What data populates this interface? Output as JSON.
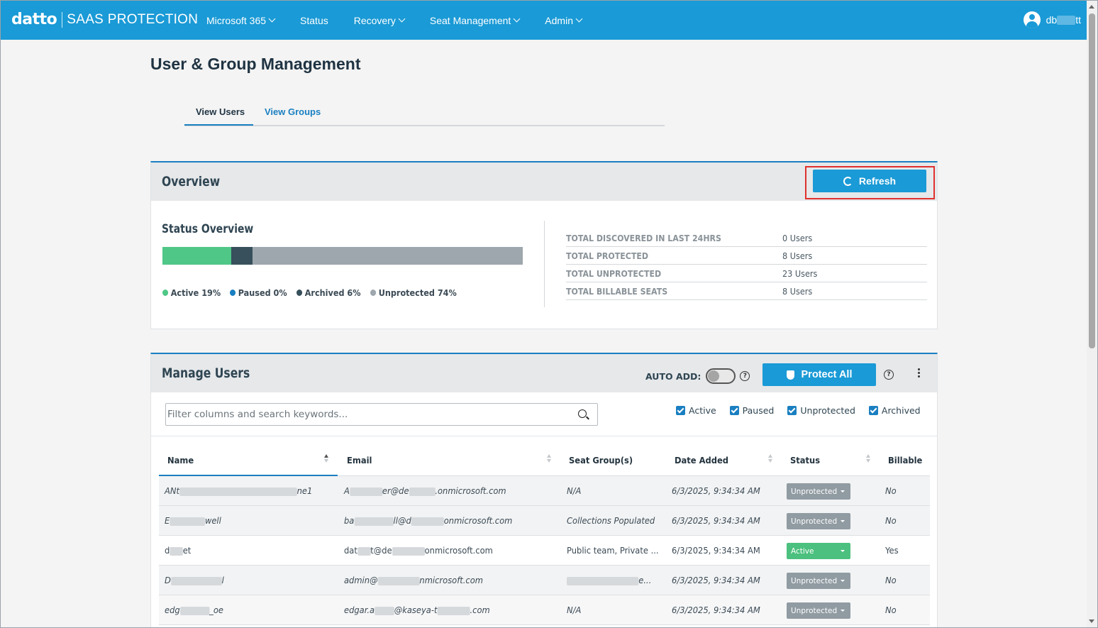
{
  "nav": {
    "logo_brand": "datto",
    "logo_product": "SAAS PROTECTION",
    "items": [
      {
        "label": "Microsoft 365",
        "dropdown": true
      },
      {
        "label": "Status",
        "dropdown": false
      },
      {
        "label": "Recovery",
        "dropdown": true
      },
      {
        "label": "Seat Management",
        "dropdown": true
      },
      {
        "label": "Admin",
        "dropdown": true
      }
    ],
    "user_prefix": "db",
    "user_suffix": "tt"
  },
  "page": {
    "title": "User & Group Management",
    "tabs": [
      "View Users",
      "View Groups"
    ]
  },
  "overview": {
    "title": "Overview",
    "refresh_label": "Refresh",
    "status_title": "Status Overview",
    "bar": [
      {
        "status": "Active",
        "percent": 19,
        "color": "#4fc787"
      },
      {
        "status": "Paused",
        "percent": 0,
        "color": "#1a7fc1"
      },
      {
        "status": "Archived",
        "percent": 6,
        "color": "#37505c"
      },
      {
        "status": "Unprotected",
        "percent": 74,
        "color": "#9da7ad"
      }
    ],
    "legend": [
      "Active 19%",
      "Paused 0%",
      "Archived 6%",
      "Unprotected 74%"
    ],
    "stats": [
      {
        "label": "TOTAL DISCOVERED IN LAST 24HRS",
        "value": "0 Users"
      },
      {
        "label": "TOTAL PROTECTED",
        "value": "8 Users"
      },
      {
        "label": "TOTAL UNPROTECTED",
        "value": "23 Users"
      },
      {
        "label": "TOTAL BILLABLE SEATS",
        "value": "8 Users"
      }
    ]
  },
  "manage": {
    "title": "Manage Users",
    "auto_add_label": "AUTO ADD:",
    "help_glyph": "?",
    "protect_all_label": "Protect All",
    "search_placeholder": "Filter columns and search keywords...",
    "filters": [
      "Active",
      "Paused",
      "Unprotected",
      "Archived"
    ],
    "columns": [
      "Name",
      "Email",
      "Seat Group(s)",
      "Date Added",
      "Status",
      "Billable"
    ],
    "rows": [
      {
        "name_a": "ANt",
        "name_b": "ne1",
        "email_a": "A",
        "email_b": "er@de",
        "email_c": ".onmicrosoft.com",
        "group": "N/A",
        "date": "6/3/2025, 9:34:34 AM",
        "status": "Unprotected",
        "billable": "No",
        "italic": true
      },
      {
        "name_a": "E",
        "name_b": "well",
        "email_a": "ba",
        "email_b": "ll@d",
        "email_c": "onmicrosoft.com",
        "group": "Collections Populated",
        "date": "6/3/2025, 9:34:34 AM",
        "status": "Unprotected",
        "billable": "No",
        "italic": true
      },
      {
        "name_a": "d",
        "name_b": "et",
        "email_a": "dat",
        "email_b": "t@de",
        "email_c": "onmicrosoft.com",
        "group": "Public team, Private ...",
        "date": "6/3/2025, 9:34:34 AM",
        "status": "Active",
        "billable": "Yes",
        "italic": false
      },
      {
        "name_a": "D",
        "name_b": "l",
        "email_a": "admin@",
        "email_b": "",
        "email_c": "nmicrosoft.com",
        "group": "e...",
        "date": "6/3/2025, 9:34:34 AM",
        "status": "Unprotected",
        "billable": "No",
        "italic": true
      },
      {
        "name_a": "edg",
        "name_b": "_oe",
        "email_a": "edgar.a",
        "email_b": "@kaseya-t",
        "email_c": ".com",
        "group": "N/A",
        "date": "6/3/2025, 9:34:34 AM",
        "status": "Unprotected",
        "billable": "No",
        "italic": true
      }
    ]
  }
}
